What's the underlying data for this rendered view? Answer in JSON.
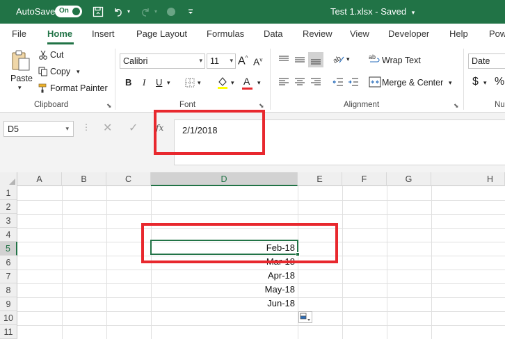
{
  "titlebar": {
    "autosave_label": "AutoSave",
    "autosave_state": "On",
    "document_title": "Test 1.xlsx  -  Saved",
    "title_caret": "⌄",
    "background_color": "#217346"
  },
  "tabs": [
    {
      "label": "File"
    },
    {
      "label": "Home"
    },
    {
      "label": "Insert"
    },
    {
      "label": "Page Layout"
    },
    {
      "label": "Formulas"
    },
    {
      "label": "Data"
    },
    {
      "label": "Review"
    },
    {
      "label": "View"
    },
    {
      "label": "Developer"
    },
    {
      "label": "Help"
    },
    {
      "label": "Pow"
    }
  ],
  "ribbon": {
    "clipboard": {
      "paste_label": "Paste",
      "cut_label": "Cut",
      "copy_label": "Copy",
      "format_painter_label": "Format Painter",
      "group_label": "Clipboard"
    },
    "font": {
      "font_name": "Calibri",
      "font_size": "11",
      "bold": "B",
      "italic": "I",
      "underline": "U",
      "grow": "A",
      "shrink": "A",
      "font_color_glyph": "A",
      "group_label": "Font",
      "fill_color": "#ffff00",
      "font_color": "#e8282e"
    },
    "alignment": {
      "wrap_text_label": "Wrap Text",
      "merge_center_label": "Merge & Center",
      "group_label": "Alignment"
    },
    "number": {
      "format_value": "Date",
      "currency_glyph": "$",
      "percent_glyph": "%",
      "group_label": "Nu"
    }
  },
  "formula_bar": {
    "name_box": "D5",
    "cancel_glyph": "✕",
    "enter_glyph": "✓",
    "fx_label": "fx",
    "formula_value": "2/1/2018"
  },
  "grid": {
    "columns": [
      "A",
      "B",
      "C",
      "D",
      "E",
      "F",
      "G",
      "H"
    ],
    "rows": [
      "1",
      "2",
      "3",
      "4",
      "5",
      "6",
      "7",
      "8",
      "9",
      "10",
      "11"
    ],
    "selected_column": "D",
    "selected_row": "5",
    "cells_d": [
      {
        "row": "5",
        "value": "Feb-18"
      },
      {
        "row": "6",
        "value": "Mar-18"
      },
      {
        "row": "7",
        "value": "Apr-18"
      },
      {
        "row": "8",
        "value": "May-18"
      },
      {
        "row": "9",
        "value": "Jun-18"
      }
    ]
  },
  "annotation_color": "#e8282e"
}
